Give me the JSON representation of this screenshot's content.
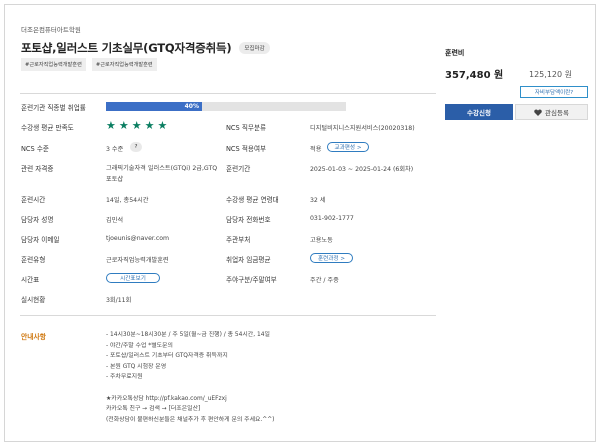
{
  "academy": "더조은컴퓨터아트학원",
  "course": {
    "title": "포토샵,일러스트 기초실무(GTQ자격증취득)",
    "badge": "모집마감",
    "tags": [
      "#근로자직업능력개발훈련",
      "#근로자직업능력개발훈련"
    ]
  },
  "pricing": {
    "label": "훈련비",
    "total": "357,480 원",
    "self_pay": "125,120 원",
    "self_pay_button": "자비부담액이란?",
    "apply_button": "수강신청",
    "favorite_button": "관심등록"
  },
  "details": {
    "employment_rate_label": "훈련기관 직종별 취업률",
    "employment_rate": 40,
    "employment_rate_text": "40%",
    "satisfaction_label": "수강생 평균 만족도",
    "satisfaction_stars": 5,
    "ncs_job_label": "NCS 직무분류",
    "ncs_job": "디지털비지니스지원서비스(20020318)",
    "ncs_level_label": "NCS 수준",
    "ncs_level": "3 수준",
    "ncs_level_button": "?",
    "ncs_applied_label": "NCS 적용여부",
    "ncs_applied": "적용",
    "curriculum_button": "교과편성 >",
    "cert_label": "관련 자격증",
    "cert_line1": "그래픽기술자격 일러스트(GTQi) 2급,GTQ",
    "cert_line2": "포토샵",
    "period_label": "훈련기간",
    "period": "2025-01-03 ~ 2025-01-24 (6회차)",
    "hours_label": "훈련시간",
    "hours": "14일, 총54시간",
    "avg_age_label": "수강생 평균 연령대",
    "avg_age": "32 세",
    "manager_label": "담당자 성명",
    "manager": "김민석",
    "phone_label": "담당자 전화번호",
    "phone": "031-902-1777",
    "email_label": "담당자 이메일",
    "email": "tjoeunis@naver.com",
    "ministry_label": "주관부처",
    "ministry": "고용노동",
    "type_label": "훈련유형",
    "type": "근로자직업능력개발훈련",
    "wage_label": "취업자 임금평균",
    "wage_button": "훈련과정 >",
    "timetable_label": "시간표",
    "timetable_button": "시간표보기",
    "weekday_label": "주야구분/주말여부",
    "weekday": "주간 / 주중",
    "status_label": "실시현황",
    "status": "3회/11회"
  },
  "guide": {
    "label": "안내사항",
    "lines": [
      "- 14시30분~18시30분 / 주 5일(월~금 진행) / 총 54시간, 14일",
      "- 야간/주말 수업 *별도문의",
      "- 포토샵/일러스트 기초부터 GTQ자격증 취득까지",
      "- 본원 GTQ 시험장 운영",
      "- 주차무료지원",
      "",
      "★카카오톡상담 http://pf.kakao.com/_uEFzxj",
      "카카오톡 친구 → 검색 → [더조은일산]",
      "(전화상담이 불편하신분들은 채널추가 후 편안하게 문의 주세요.^^)"
    ]
  },
  "colors": {
    "primary": "#2b5ea8",
    "progress": "#3c6fc6",
    "star": "#0a7e61",
    "guide_label": "#d07a13"
  }
}
